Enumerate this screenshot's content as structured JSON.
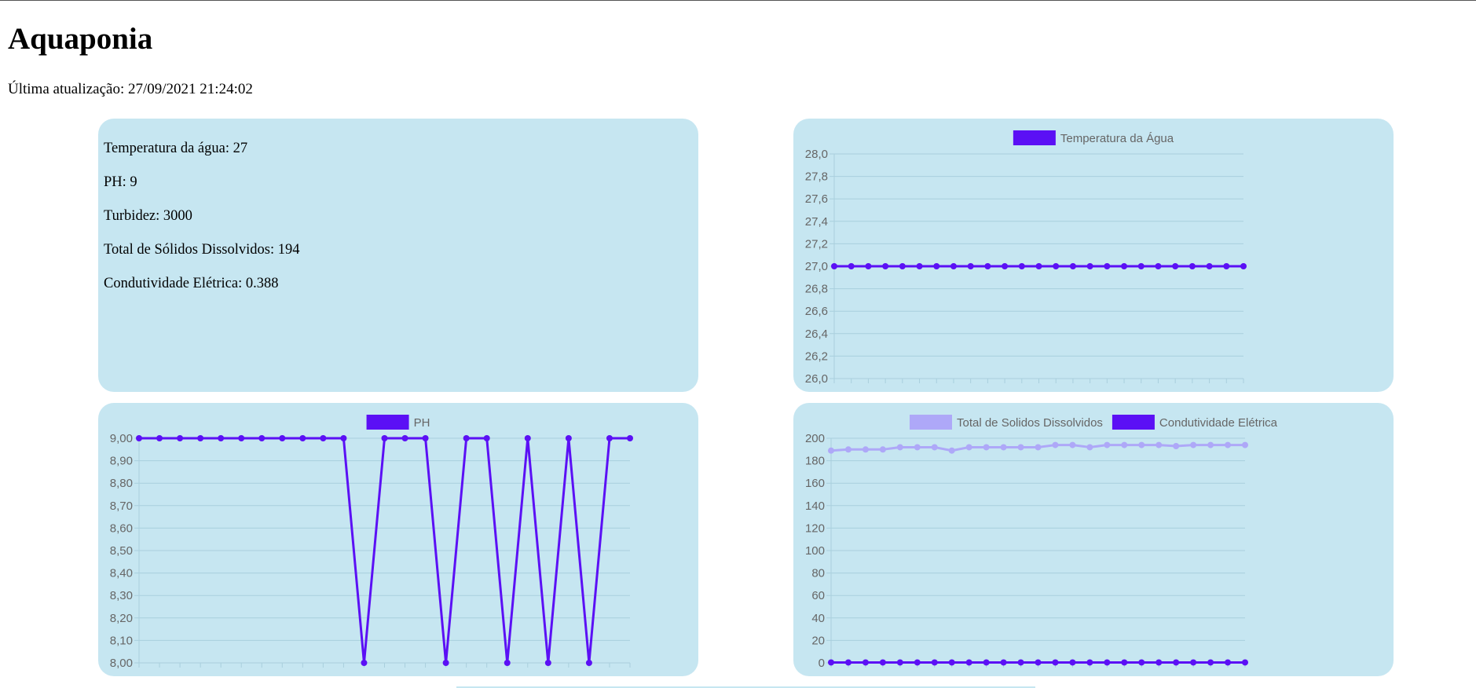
{
  "page": {
    "title": "Aquaponia",
    "last_update_label": "Última atualização:",
    "last_update_value": "27/09/2021 21:24:02"
  },
  "readings": {
    "temperature": {
      "label": "Temperatura da água:",
      "value": "27"
    },
    "ph": {
      "label": "PH:",
      "value": "9"
    },
    "turbidity": {
      "label": "Turbidez:",
      "value": "3000"
    },
    "tds": {
      "label": "Total de Sólidos Dissolvidos:",
      "value": "194"
    },
    "conductivity": {
      "label": "Condutividade Elétrica:",
      "value": "0.388"
    }
  },
  "colors": {
    "panel_bg": "#c6e6f1",
    "grid": "#a9cfdd",
    "axis_text": "#666666",
    "series_primary": "#5b10f5",
    "series_light": "#aea8f8"
  },
  "chart_data": [
    {
      "id": "temp",
      "type": "line",
      "x": [
        "",
        "",
        "",
        "",
        "",
        "",
        "",
        "",
        "",
        "",
        "",
        "",
        "",
        "",
        "",
        "",
        "",
        "",
        "",
        "",
        "",
        "",
        "",
        "",
        ""
      ],
      "series": [
        {
          "name": "Temperatura da Água",
          "color": "#5b10f5",
          "values": [
            27,
            27,
            27,
            27,
            27,
            27,
            27,
            27,
            27,
            27,
            27,
            27,
            27,
            27,
            27,
            27,
            27,
            27,
            27,
            27,
            27,
            27,
            27,
            27,
            27
          ]
        }
      ],
      "ylim": [
        26.0,
        28.0
      ],
      "yticks": [
        "28,0",
        "27,8",
        "27,6",
        "27,4",
        "27,2",
        "27,0",
        "26,8",
        "26,6",
        "26,4",
        "26,2",
        "26,0"
      ],
      "grid": true,
      "legend": "top-center"
    },
    {
      "id": "ph",
      "type": "line",
      "x": [
        "",
        "",
        "",
        "",
        "",
        "",
        "",
        "",
        "",
        "",
        "",
        "",
        "",
        "",
        "",
        "",
        "",
        "",
        "",
        "",
        "",
        "",
        "",
        "",
        ""
      ],
      "series": [
        {
          "name": "PH",
          "color": "#5b10f5",
          "values": [
            9,
            9,
            9,
            9,
            9,
            9,
            9,
            9,
            9,
            9,
            9,
            8,
            9,
            9,
            9,
            8,
            9,
            9,
            8,
            9,
            8,
            9,
            8,
            9,
            9
          ]
        }
      ],
      "ylim": [
        8.0,
        9.0
      ],
      "yticks": [
        "9,00",
        "8,90",
        "8,80",
        "8,70",
        "8,60",
        "8,50",
        "8,40",
        "8,30",
        "8,20",
        "8,10",
        "8,00"
      ],
      "grid": true,
      "legend": "top-center"
    },
    {
      "id": "sol",
      "type": "line",
      "x": [
        "",
        "",
        "",
        "",
        "",
        "",
        "",
        "",
        "",
        "",
        "",
        "",
        "",
        "",
        "",
        "",
        "",
        "",
        "",
        "",
        "",
        "",
        "",
        "",
        ""
      ],
      "series": [
        {
          "name": "Total de Solidos Dissolvidos",
          "color": "#aea8f8",
          "values": [
            189,
            190,
            190,
            190,
            192,
            192,
            192,
            189,
            192,
            192,
            192,
            192,
            192,
            194,
            194,
            192,
            194,
            194,
            194,
            194,
            193,
            194,
            194,
            194,
            194
          ]
        },
        {
          "name": "Condutividade Elétrica",
          "color": "#5b10f5",
          "values": [
            0.38,
            0.38,
            0.38,
            0.38,
            0.384,
            0.384,
            0.384,
            0.378,
            0.384,
            0.384,
            0.384,
            0.384,
            0.384,
            0.388,
            0.388,
            0.384,
            0.388,
            0.388,
            0.388,
            0.388,
            0.386,
            0.388,
            0.388,
            0.388,
            0.388
          ]
        }
      ],
      "ylim": [
        0,
        200
      ],
      "yticks": [
        "200",
        "180",
        "160",
        "140",
        "120",
        "100",
        "80",
        "60",
        "40",
        "20",
        "0"
      ],
      "grid": true,
      "legend": "top-center"
    }
  ]
}
